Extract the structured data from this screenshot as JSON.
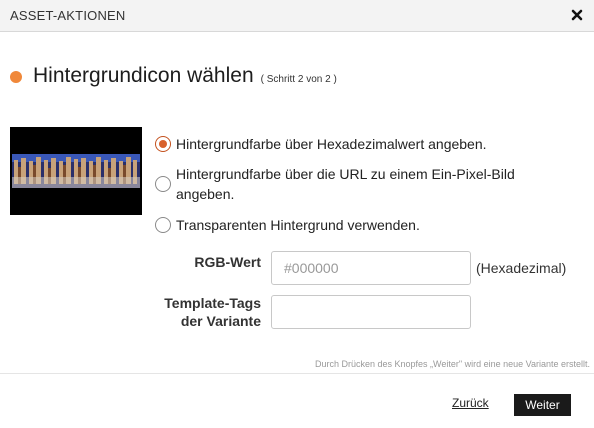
{
  "dialog": {
    "title": "ASSET-AKTIONEN",
    "close_icon": "close-x-icon"
  },
  "heading": {
    "title": "Hintergrundicon wählen",
    "step": "( Schritt 2 von 2 )",
    "bullet_color": "#f0883a"
  },
  "preview": {
    "thumbnail": "image-thumbnail"
  },
  "background_options": {
    "selected_index": 0,
    "items": [
      {
        "label": "Hintergrundfarbe über Hexadezimalwert angeben."
      },
      {
        "label": "Hintergrundfarbe über die URL zu einem Ein-Pixel-Bild angeben."
      },
      {
        "label": "Transparenten Hintergrund verwenden."
      }
    ]
  },
  "form": {
    "rgb_label": "RGB-Wert",
    "rgb_placeholder": "#000000",
    "rgb_value": "",
    "rgb_hint": "(Hexadezimal)",
    "tags_label_line1": "Template-Tags",
    "tags_label_line2": "der Variante",
    "tags_value": ""
  },
  "footer": {
    "note": "Durch Drücken des Knopfes „Weiter\" wird eine neue Variante erstellt.",
    "back_label": "Zurück",
    "next_label": "Weiter"
  }
}
